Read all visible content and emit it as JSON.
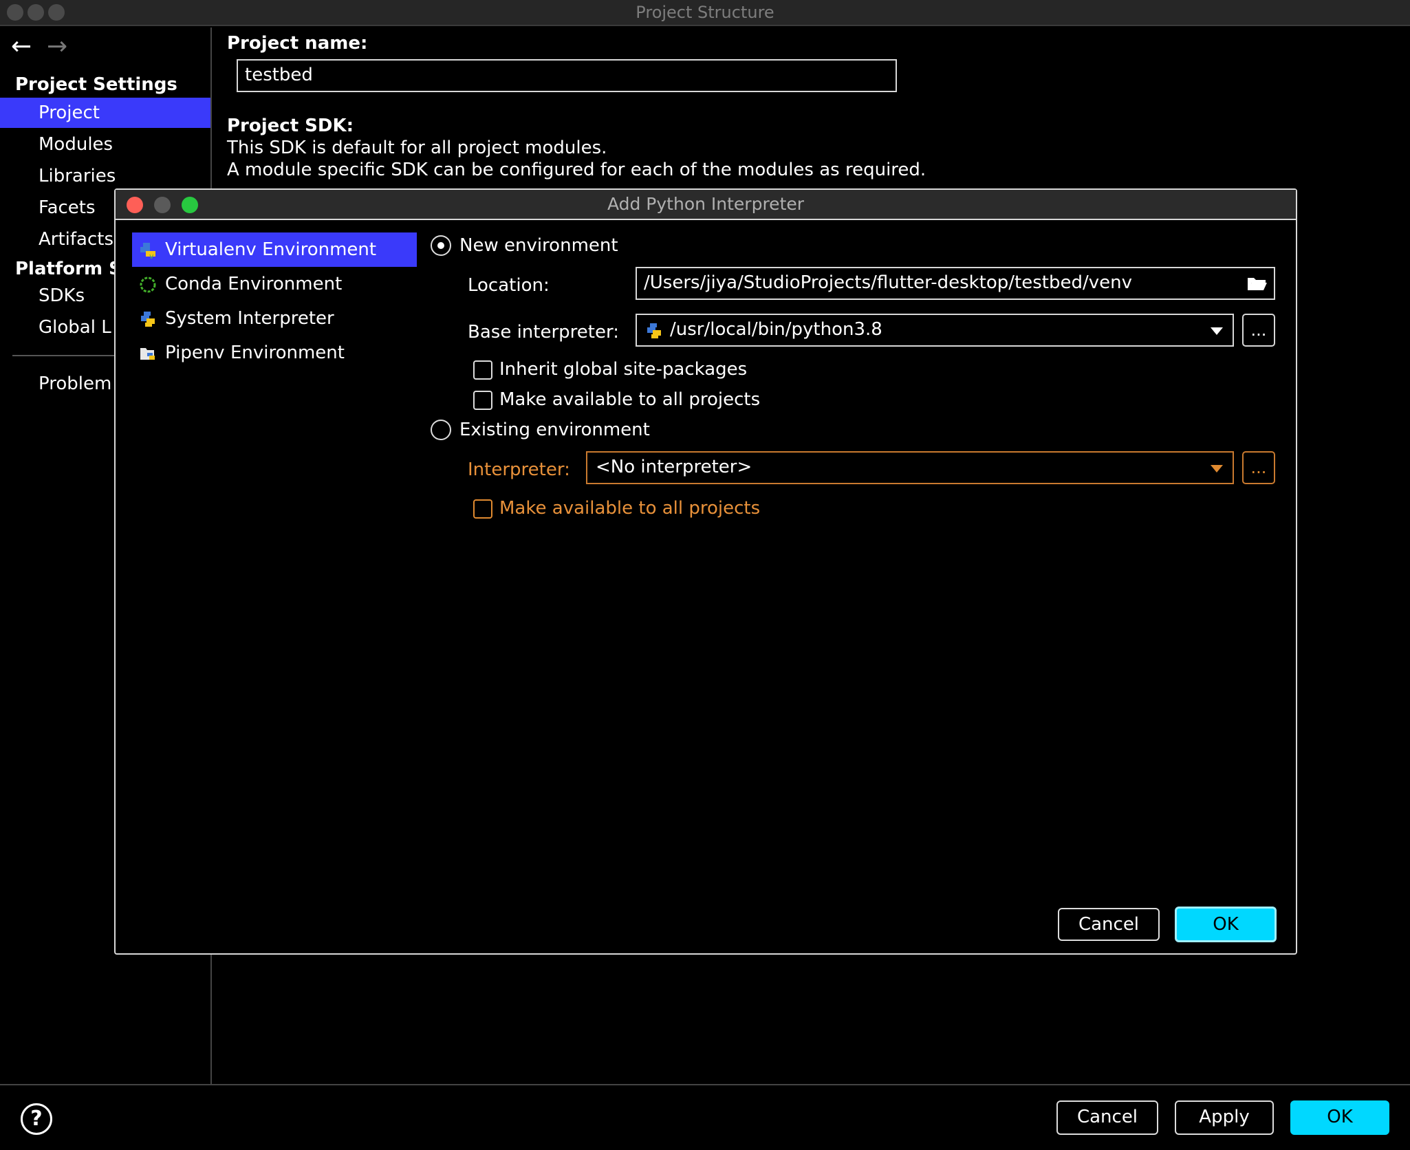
{
  "window": {
    "title": "Project Structure"
  },
  "nav": {
    "back_icon": "←",
    "forward_icon": "→",
    "project_settings_header": "Project Settings",
    "project_settings_items": [
      "Project",
      "Modules",
      "Libraries",
      "Facets",
      "Artifacts"
    ],
    "platform_header": "Platform S",
    "platform_items": [
      "SDKs",
      "Global L"
    ],
    "problems_item": "Problem"
  },
  "main": {
    "project_name_label": "Project name:",
    "project_name_value": "testbed",
    "project_sdk_label": "Project SDK:",
    "sdk_desc_line1": "This SDK is default for all project modules.",
    "sdk_desc_line2": "A module specific SDK can be configured for each of the modules as required."
  },
  "bottom": {
    "help_label": "?",
    "cancel_label": "Cancel",
    "apply_label": "Apply",
    "ok_label": "OK"
  },
  "dialog": {
    "title": "Add Python Interpreter",
    "env_types": [
      {
        "label": "Virtualenv Environment",
        "icon": "virtualenv-icon"
      },
      {
        "label": "Conda Environment",
        "icon": "conda-icon"
      },
      {
        "label": "System Interpreter",
        "icon": "python-icon"
      },
      {
        "label": "Pipenv Environment",
        "icon": "pipenv-icon"
      }
    ],
    "new_env_label": "New environment",
    "location_label": "Location:",
    "location_value": "/Users/jiya/StudioProjects/flutter-desktop/testbed/venv",
    "base_interpreter_label": "Base interpreter:",
    "base_interpreter_value": "/usr/local/bin/python3.8",
    "browse_label": "...",
    "inherit_label": "Inherit global site-packages",
    "make_available_label": "Make available to all projects",
    "existing_env_label": "Existing environment",
    "interpreter_label": "Interpreter:",
    "interpreter_value": "<No interpreter>",
    "existing_make_available_label": "Make available to all projects",
    "cancel_label": "Cancel",
    "ok_label": "OK"
  },
  "colors": {
    "selection": "#3a3afa",
    "primary_button": "#00d8ff",
    "warning_orange": "#e8913a",
    "close_red": "#fe5f57",
    "minimize_gray": "#5a5a5a",
    "zoom_green": "#28c840"
  }
}
